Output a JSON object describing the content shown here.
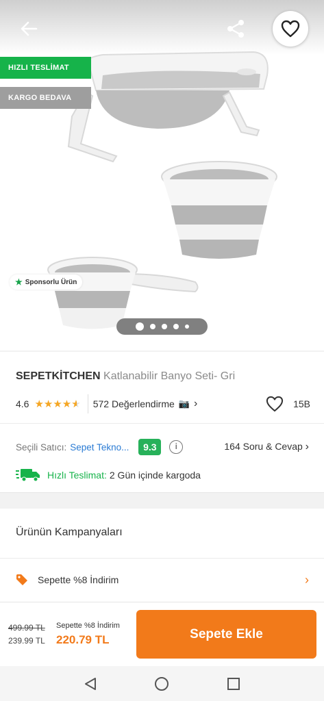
{
  "hero": {
    "badges": [
      "HIZLI TESLİMAT",
      "KARGO BEDAVA"
    ],
    "sponsored_label": "Sponsorlu Ürün",
    "image_count": 5,
    "active_image": 1,
    "icons": [
      "back-arrow-icon",
      "share-icon",
      "heart-icon"
    ]
  },
  "product": {
    "brand": "SEPETKİTCHEN",
    "name": "Katlanabilir Banyo Seti- Gri",
    "rating": "4.6",
    "stars_value": 4.6,
    "reviews": "572 Değerlendirme",
    "favorites": "15B"
  },
  "seller": {
    "label": "Seçili Satıcı:",
    "name": "Sepet Tekno...",
    "score": "9.3",
    "qa": "164 Soru & Cevap"
  },
  "shipping": {
    "label": "Hızlı Teslimat:",
    "text": "2 Gün içinde kargoda"
  },
  "campaigns": {
    "title": "Ürünün Kampanyaları",
    "items": [
      {
        "label": "Sepette %8 İndirim"
      }
    ]
  },
  "bottom": {
    "old_price": "499.99 TL",
    "current_price": "239.99 TL",
    "promo_label": "Sepette %8 İndirim",
    "promo_price": "220.79 TL",
    "cta": "Sepete Ekle"
  },
  "colors": {
    "accent": "#f27a1a",
    "green": "#16b34a",
    "link": "#2a7bd4",
    "star": "#f5a623"
  }
}
